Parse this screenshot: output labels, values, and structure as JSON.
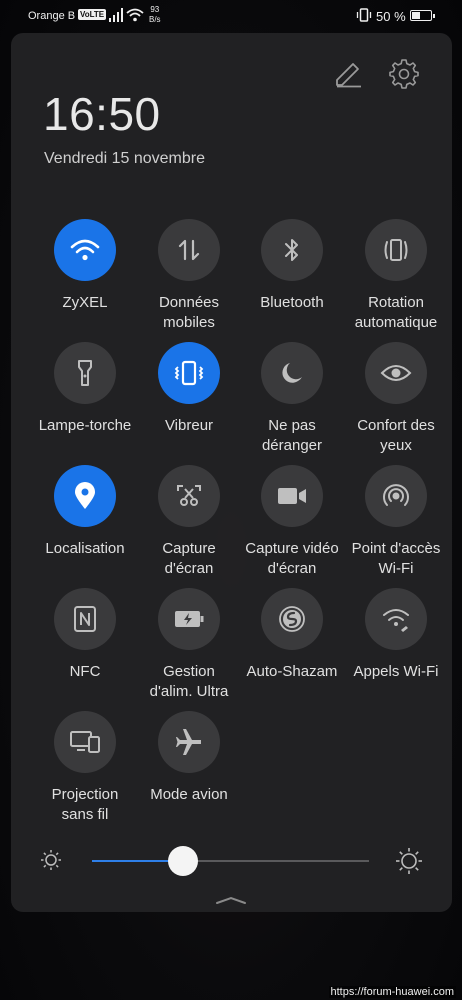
{
  "status_bar": {
    "carrier": "Orange B",
    "volte": "VoLTE",
    "speed_value": "93",
    "speed_unit": "B/s",
    "battery_percent": "50 %",
    "battery_level": 0.5
  },
  "panel": {
    "time": "16:50",
    "date": "Vendredi 15 novembre",
    "tiles": [
      {
        "label1": "ZyXEL",
        "label2": "",
        "icon": "wifi-icon",
        "active": true
      },
      {
        "label1": "Données",
        "label2": "mobiles",
        "icon": "mobile-data-icon",
        "active": false
      },
      {
        "label1": "Bluetooth",
        "label2": "",
        "icon": "bluetooth-icon",
        "active": false
      },
      {
        "label1": "Rotation",
        "label2": "automatique",
        "icon": "auto-rotate-icon",
        "active": false
      },
      {
        "label1": "Lampe-torche",
        "label2": "",
        "icon": "flashlight-icon",
        "active": false
      },
      {
        "label1": "Vibreur",
        "label2": "",
        "icon": "vibrate-icon",
        "active": true
      },
      {
        "label1": "Ne pas",
        "label2": "déranger",
        "icon": "moon-icon",
        "active": false
      },
      {
        "label1": "Confort des",
        "label2": "yeux",
        "icon": "eye-icon",
        "active": false
      },
      {
        "label1": "Localisation",
        "label2": "",
        "icon": "location-icon",
        "active": true
      },
      {
        "label1": "Capture",
        "label2": "d'écran",
        "icon": "screenshot-icon",
        "active": false
      },
      {
        "label1": "Capture vidéo",
        "label2": "d'écran",
        "icon": "screen-record-icon",
        "active": false
      },
      {
        "label1": "Point d'accès",
        "label2": "Wi-Fi",
        "icon": "hotspot-icon",
        "active": false
      },
      {
        "label1": "NFC",
        "label2": "",
        "icon": "nfc-icon",
        "active": false
      },
      {
        "label1": "Gestion",
        "label2": "d'alim. Ultra",
        "icon": "battery-saver-icon",
        "active": false
      },
      {
        "label1": "Auto-Shazam",
        "label2": "",
        "icon": "shazam-icon",
        "active": false
      },
      {
        "label1": "Appels Wi-Fi",
        "label2": "",
        "icon": "wifi-calling-icon",
        "active": false
      },
      {
        "label1": "Projection",
        "label2": "sans fil",
        "icon": "wireless-projection-icon",
        "active": false
      },
      {
        "label1": "Mode avion",
        "label2": "",
        "icon": "airplane-icon",
        "active": false
      }
    ],
    "brightness_level": 0.33
  },
  "watermark": "https://forum-huawei.com",
  "colors": {
    "active_tile": "#1a74e8",
    "inactive_tile": "#3a3a3c",
    "panel_bg": "#222224"
  }
}
